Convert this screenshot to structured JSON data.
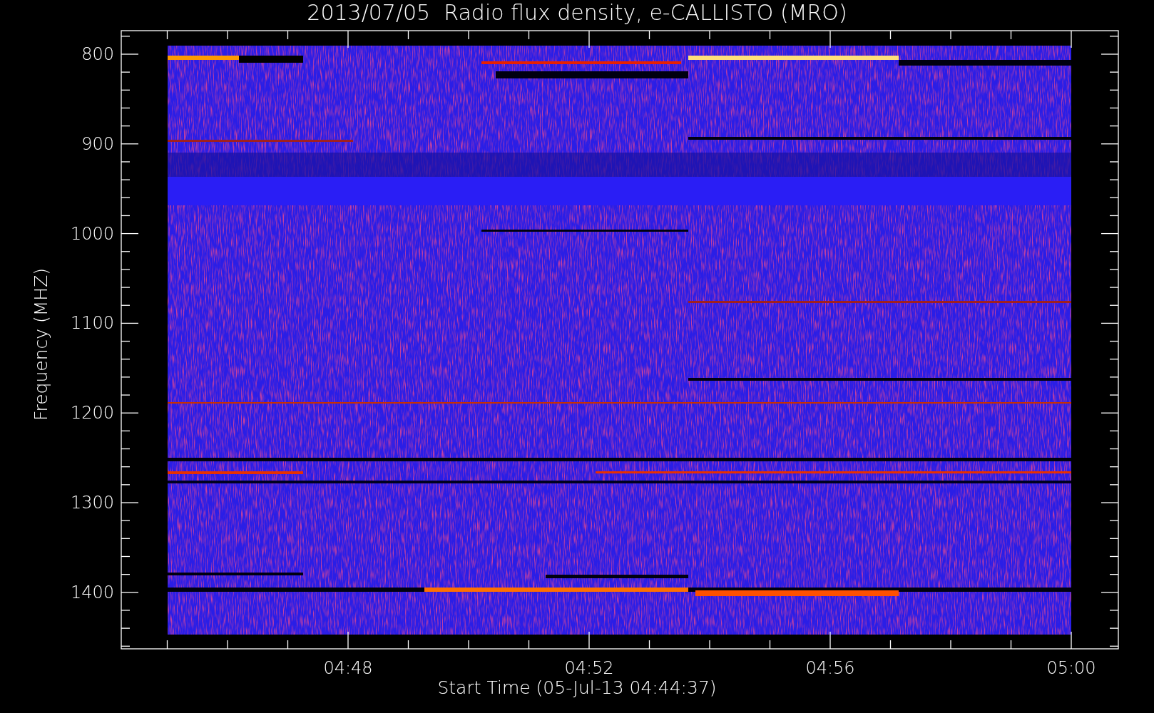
{
  "title": "2013/07/05  Radio flux density, e-CALLISTO (MRO)",
  "y_axis": {
    "label": "Frequency (MHZ)",
    "ticks": [
      "800",
      "900",
      "1000",
      "1100",
      "1200",
      "1300",
      "1400"
    ]
  },
  "x_axis": {
    "label": "Start Time (05-Jul-13 04:44:37)",
    "ticks": [
      "04:48",
      "04:52",
      "04:56",
      "05:00"
    ]
  }
}
